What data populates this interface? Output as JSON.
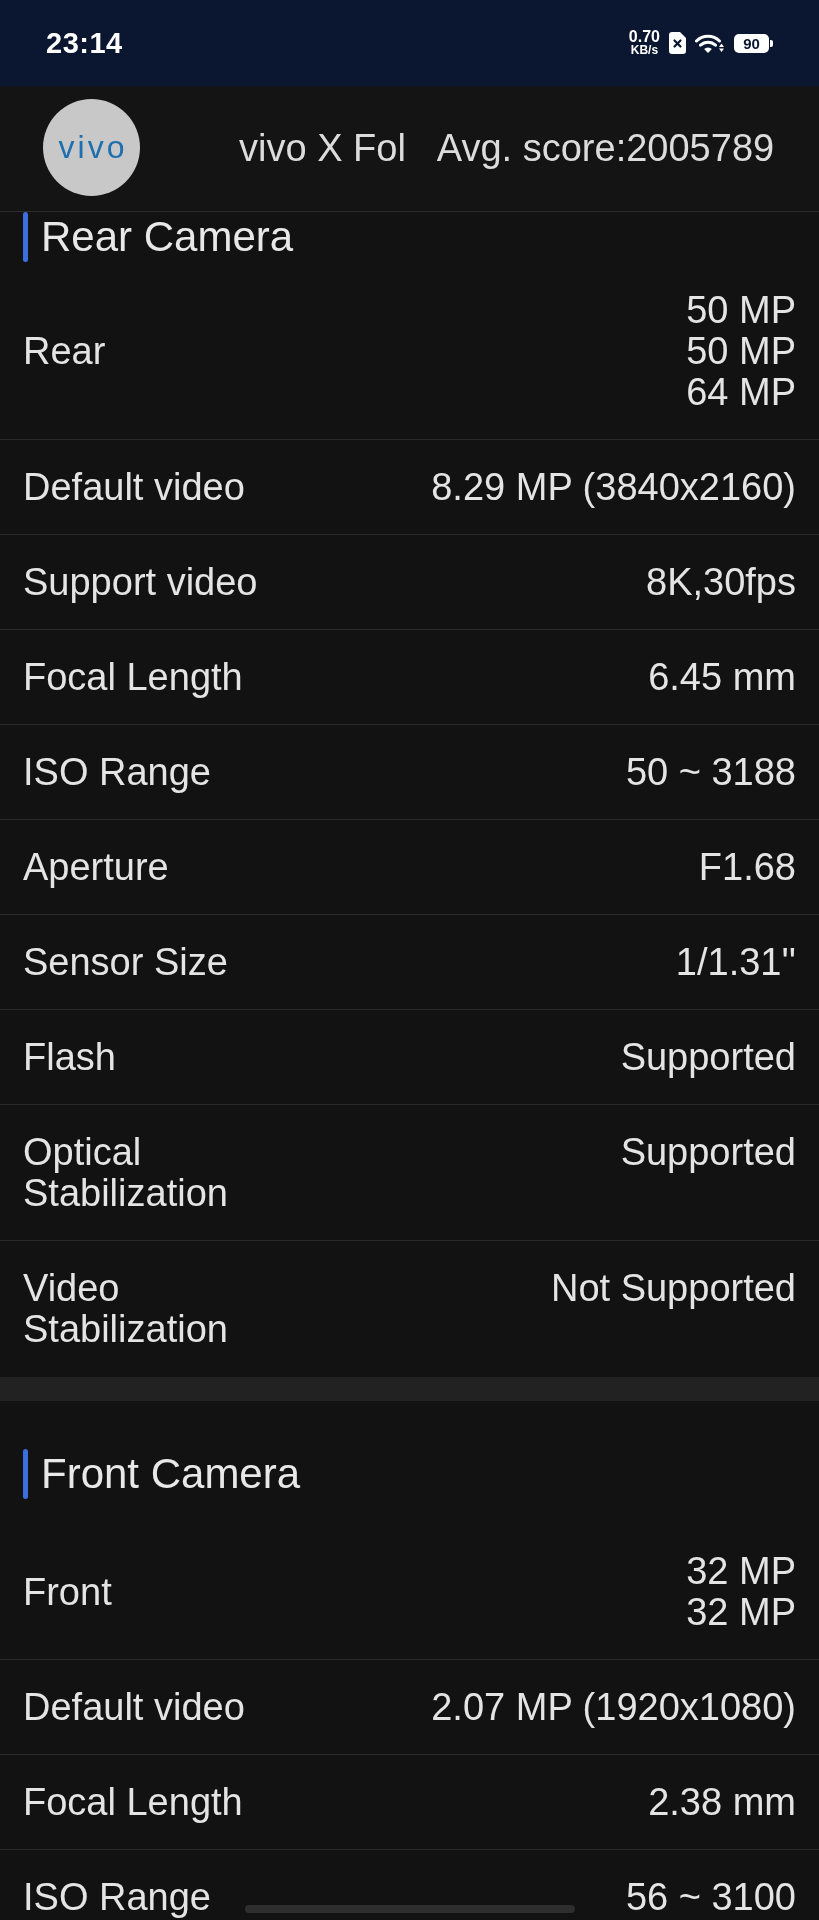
{
  "status_bar": {
    "time": "23:14",
    "network_speed": {
      "value": "0.70",
      "unit": "KB/s"
    },
    "battery": "90"
  },
  "header": {
    "logo_text": "vivo",
    "device_name": "vivo X Fol",
    "avg_score": "Avg. score:2005789"
  },
  "sections": [
    {
      "title": "Rear Camera",
      "rows": [
        {
          "label": "Rear",
          "values": [
            "50 MP",
            "50 MP",
            "64 MP"
          ]
        },
        {
          "label": "Default video",
          "values": [
            "8.29 MP (3840x2160)"
          ]
        },
        {
          "label": "Support video",
          "values": [
            "8K,30fps"
          ]
        },
        {
          "label": "Focal Length",
          "values": [
            "6.45 mm"
          ]
        },
        {
          "label": "ISO Range",
          "values": [
            "50 ~ 3188"
          ]
        },
        {
          "label": "Aperture",
          "values": [
            "F1.68"
          ]
        },
        {
          "label": "Sensor Size",
          "values": [
            "1/1.31''"
          ]
        },
        {
          "label": "Flash",
          "values": [
            "Supported"
          ]
        },
        {
          "label": "Optical Stabilization",
          "values": [
            "Supported"
          ]
        },
        {
          "label": "Video Stabilization",
          "values": [
            "Not Supported"
          ]
        }
      ]
    },
    {
      "title": "Front Camera",
      "rows": [
        {
          "label": "Front",
          "values": [
            "32 MP",
            "32 MP"
          ]
        },
        {
          "label": "Default video",
          "values": [
            "2.07 MP (1920x1080)"
          ]
        },
        {
          "label": "Focal Length",
          "values": [
            "2.38 mm"
          ]
        },
        {
          "label": "ISO Range",
          "values": [
            "56 ~ 3100"
          ]
        }
      ]
    }
  ]
}
